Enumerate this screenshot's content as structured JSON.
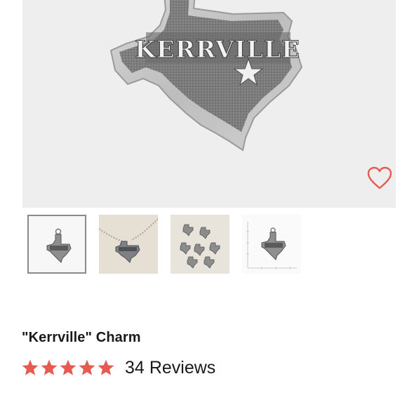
{
  "product": {
    "engraving": "KERRVILLE",
    "title": "\"Kerrville\" Charm",
    "rating": 5,
    "rating_max": 5,
    "review_count": "34",
    "review_label": "Reviews"
  },
  "gallery": {
    "thumbnails": [
      {
        "name": "thumb-front-view",
        "selected": true
      },
      {
        "name": "thumb-on-necklace",
        "selected": false
      },
      {
        "name": "thumb-group-of-charms",
        "selected": false
      },
      {
        "name": "thumb-size-scale",
        "selected": false
      }
    ]
  },
  "icons": {
    "favorite": "heart-outline-icon",
    "rating_star": "star-icon"
  },
  "colors": {
    "star": "#e55b50",
    "heart": "#e55b50",
    "hero_background": "#eeeeee",
    "selected_border": "#8a8a8a"
  }
}
